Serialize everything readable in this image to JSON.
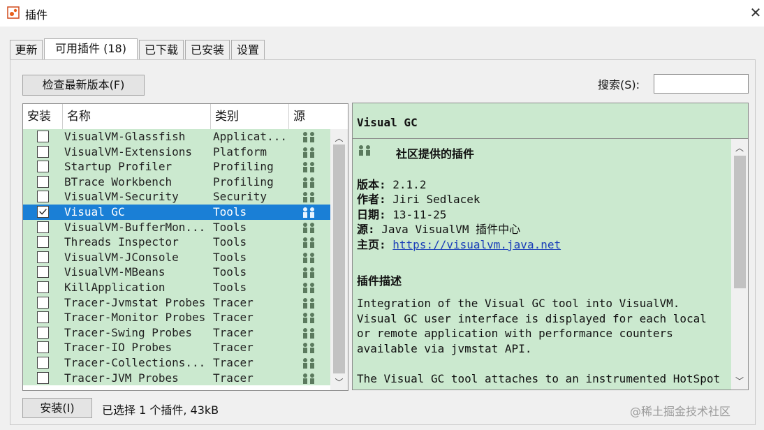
{
  "window": {
    "title": "插件",
    "close_symbol": "✕"
  },
  "tabs": [
    {
      "label": "更新"
    },
    {
      "label": "可用插件 (18)"
    },
    {
      "label": "已下载"
    },
    {
      "label": "已安装"
    },
    {
      "label": "设置"
    }
  ],
  "toolbar": {
    "check_button": "检查最新版本(F)",
    "search_label": "搜索(S):",
    "search_value": ""
  },
  "table": {
    "headers": {
      "install": "安装",
      "name": "名称",
      "category": "类别",
      "source": "源"
    },
    "rows": [
      {
        "name": "VisualVM-Glassfish",
        "category": "Applicat...",
        "checked": false
      },
      {
        "name": "VisualVM-Extensions",
        "category": "Platform",
        "checked": false
      },
      {
        "name": "Startup Profiler",
        "category": "Profiling",
        "checked": false
      },
      {
        "name": "BTrace Workbench",
        "category": "Profiling",
        "checked": false
      },
      {
        "name": "VisualVM-Security",
        "category": "Security",
        "checked": false
      },
      {
        "name": "Visual GC",
        "category": "Tools",
        "checked": true,
        "selected": true
      },
      {
        "name": "VisualVM-BufferMon...",
        "category": "Tools",
        "checked": false
      },
      {
        "name": "Threads Inspector",
        "category": "Tools",
        "checked": false
      },
      {
        "name": "VisualVM-JConsole",
        "category": "Tools",
        "checked": false
      },
      {
        "name": "VisualVM-MBeans",
        "category": "Tools",
        "checked": false
      },
      {
        "name": "KillApplication",
        "category": "Tools",
        "checked": false
      },
      {
        "name": "Tracer-Jvmstat Probes",
        "category": "Tracer",
        "checked": false
      },
      {
        "name": "Tracer-Monitor Probes",
        "category": "Tracer",
        "checked": false
      },
      {
        "name": "Tracer-Swing Probes",
        "category": "Tracer",
        "checked": false
      },
      {
        "name": "Tracer-IO Probes",
        "category": "Tracer",
        "checked": false
      },
      {
        "name": "Tracer-Collections...",
        "category": "Tracer",
        "checked": false
      },
      {
        "name": "Tracer-JVM Probes",
        "category": "Tracer",
        "checked": false
      }
    ]
  },
  "detail": {
    "title": "Visual GC",
    "community_label": "社区提供的插件",
    "version_label": "版本:",
    "version": "2.1.2",
    "author_label": "作者:",
    "author": "Jiri Sedlacek",
    "date_label": "日期:",
    "date": "13-11-25",
    "source_label": "源:",
    "source": "Java VisualVM 插件中心",
    "homepage_label": "主页:",
    "homepage": "https://visualvm.java.net",
    "desc_heading": "插件描述",
    "desc_lines": [
      "Integration of the Visual GC tool into VisualVM.",
      "Visual GC user interface is displayed for each local",
      "or remote application with performance counters",
      "available via jvmstat API.",
      "",
      "The Visual GC tool attaches to an instrumented HotSpot"
    ]
  },
  "footer": {
    "install_button": "安装(I)",
    "status": "已选择 1 个插件, 43kB"
  },
  "watermark": "@稀土掘金技术社区",
  "colors": {
    "row_bg": "#cbe9cf",
    "selected_row": "#1a7fd6",
    "link": "#1a3fb8"
  }
}
